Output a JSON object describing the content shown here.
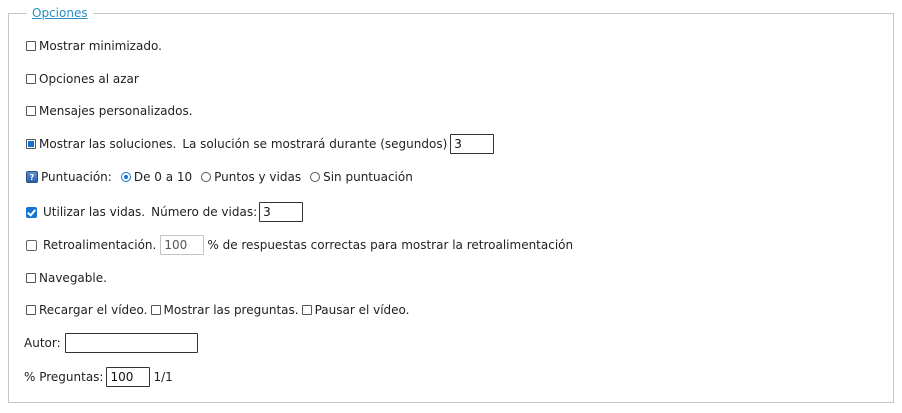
{
  "legend": "Opciones",
  "minimized": {
    "label": "Mostrar minimizado.",
    "checked": false
  },
  "random": {
    "label": "Opciones al azar",
    "checked": false
  },
  "custom_messages": {
    "label": "Mensajes personalizados.",
    "checked": false
  },
  "solutions": {
    "label": "Mostrar las soluciones.",
    "checked": true,
    "duration_label": "La solución se mostrará durante (segundos)",
    "duration_value": "3"
  },
  "scoring": {
    "icon": "help-icon",
    "label": "Puntuación:",
    "options": [
      "De 0 a 10",
      "Puntos y vidas",
      "Sin puntuación"
    ],
    "selected": "De 0 a 10"
  },
  "lives": {
    "label": "Utilizar las vidas.",
    "checked": true,
    "count_label": "Número de vidas:",
    "count_value": "3"
  },
  "feedback": {
    "label": "Retroalimentación.",
    "checked": false,
    "percent_value": "100",
    "suffix": "% de respuestas correctas para mostrar la retroalimentación"
  },
  "navigable": {
    "label": "Navegable.",
    "checked": false
  },
  "video": {
    "reload_label": "Recargar el vídeo.",
    "show_questions_label": "Mostrar las preguntas.",
    "pause_label": "Pausar el vídeo."
  },
  "author": {
    "label": "Autor:",
    "value": ""
  },
  "questions": {
    "label": "% Preguntas:",
    "value": "100",
    "count": "1/1"
  },
  "colors": {
    "accent": "#1673d1",
    "legend": "#2a8fc1",
    "border": "#c7c7c7"
  }
}
